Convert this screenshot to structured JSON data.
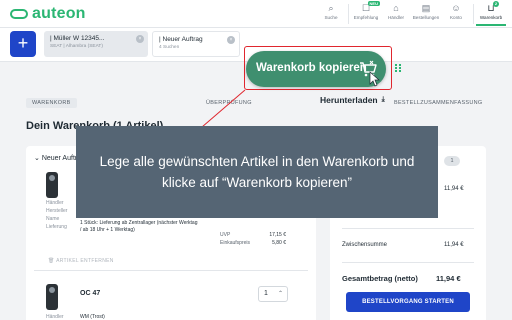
{
  "brand": {
    "name": "auteon",
    "color": "#2bb673"
  },
  "nav": [
    {
      "icon": "search-icon",
      "label": "Suche"
    },
    {
      "icon": "recommend-icon",
      "label": "Empfehlung",
      "badge": "NEU"
    },
    {
      "icon": "dealer-icon",
      "label": "Händler"
    },
    {
      "icon": "orders-icon",
      "label": "Bestellungen"
    },
    {
      "icon": "account-icon",
      "label": "Konto"
    },
    {
      "icon": "cart-icon",
      "label": "Warenkorb",
      "count": "2"
    }
  ],
  "tabs": [
    {
      "name": "| Müller W 12345...",
      "sub": "SEAT | Alhambra (SEAT)"
    },
    {
      "name": "| Neuer Auftrag",
      "sub": "4 Suchen"
    }
  ],
  "copy_button": {
    "label": "Warenkorb kopieren",
    "color": "#3f8f6f"
  },
  "steps": {
    "cart": "WARENKORB",
    "review": "ÜBERPRÜFUNG",
    "summary": "BESTELLZUSAMMENFASSUNG"
  },
  "download_label": "Herunterladen",
  "page_title": "Dein Warenkorb (1 Artikel)",
  "group_title": "Neuer Auftrag",
  "item1": {
    "labels": {
      "dealer": "Händler",
      "manufacturer": "Hersteller",
      "name": "Name",
      "delivery": "Lieferung"
    },
    "delivery": "1 Stück: Lieferung ab Zentrallager (nächster Werktag / ab 18 Uhr + 1 Werktag)",
    "uvp_label": "UVP",
    "uvp_value": "17,15 €",
    "ek_label": "Einkaufspreis",
    "ek_value": "5,80 €",
    "remove_label": "ARTIKEL ENTFERNEN"
  },
  "item2": {
    "name": "OC 47",
    "qty": "1",
    "dealer_label": "Händler",
    "dealer_value": "WM (Trost)"
  },
  "summary": {
    "count": "1",
    "line_value": "11,94 €",
    "subtotal_label": "Zwischensumme",
    "subtotal_value": "11,94 €",
    "total_label": "Gesamtbetrag (netto)",
    "total_value": "11,94 €",
    "checkout_label": "BESTELLVORGANG STARTEN"
  },
  "tooltip": "Lege alle gewünschten Artikel in den Warenkorb und klicke auf “Warenkorb kopieren”",
  "colors": {
    "accent_blue": "#1f45c8",
    "highlight_red": "#e0262e",
    "tooltip_bg": "#556574"
  }
}
